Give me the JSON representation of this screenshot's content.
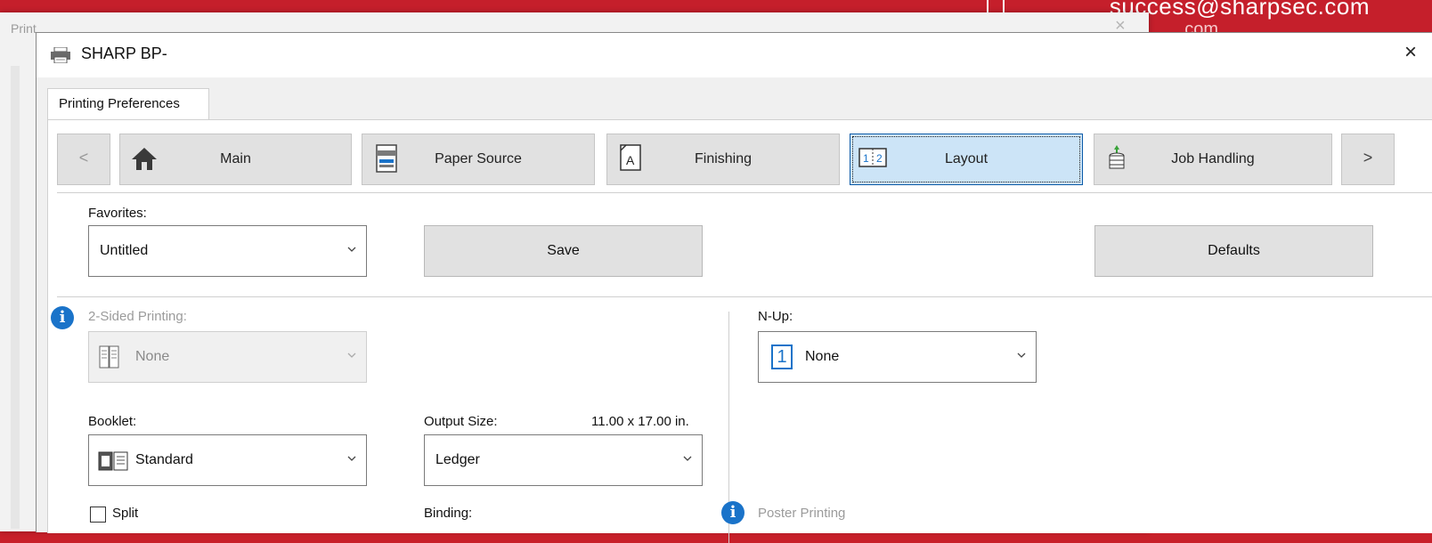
{
  "background": {
    "email_text": "success@sharpsec.com",
    "email_text2": "com",
    "behind_window_title": "Print",
    "brand_red": "#c51f2b"
  },
  "dialog": {
    "title": "SHARP BP-",
    "close_glyph": "×",
    "tab_label": "Printing Preferences"
  },
  "ribbon": {
    "prev_glyph": "<",
    "next_glyph": ">",
    "items": [
      {
        "label": "Main",
        "icon": "home-icon"
      },
      {
        "label": "Paper Source",
        "icon": "paper-tray-icon"
      },
      {
        "label": "Finishing",
        "icon": "finishing-icon"
      },
      {
        "label": "Layout",
        "icon": "layout-icon",
        "selected": true
      },
      {
        "label": "Job Handling",
        "icon": "job-handling-icon"
      }
    ]
  },
  "favorites": {
    "label": "Favorites:",
    "value": "Untitled",
    "save_label": "Save",
    "defaults_label": "Defaults"
  },
  "two_sided": {
    "label": "2-Sided Printing:",
    "value": "None",
    "disabled": true
  },
  "booklet": {
    "label": "Booklet:",
    "value": "Standard"
  },
  "output_size": {
    "label": "Output Size:",
    "dimensions": "11.00 x 17.00 in.",
    "value": "Ledger"
  },
  "nup": {
    "label": "N-Up:",
    "badge": "1",
    "value": "None"
  },
  "split": {
    "label": "Split",
    "checked": false
  },
  "binding": {
    "label": "Binding:"
  },
  "poster": {
    "label": "Poster Printing"
  },
  "colors": {
    "accent_blue": "#1a73c9",
    "selected_bg": "#cce4f7"
  }
}
